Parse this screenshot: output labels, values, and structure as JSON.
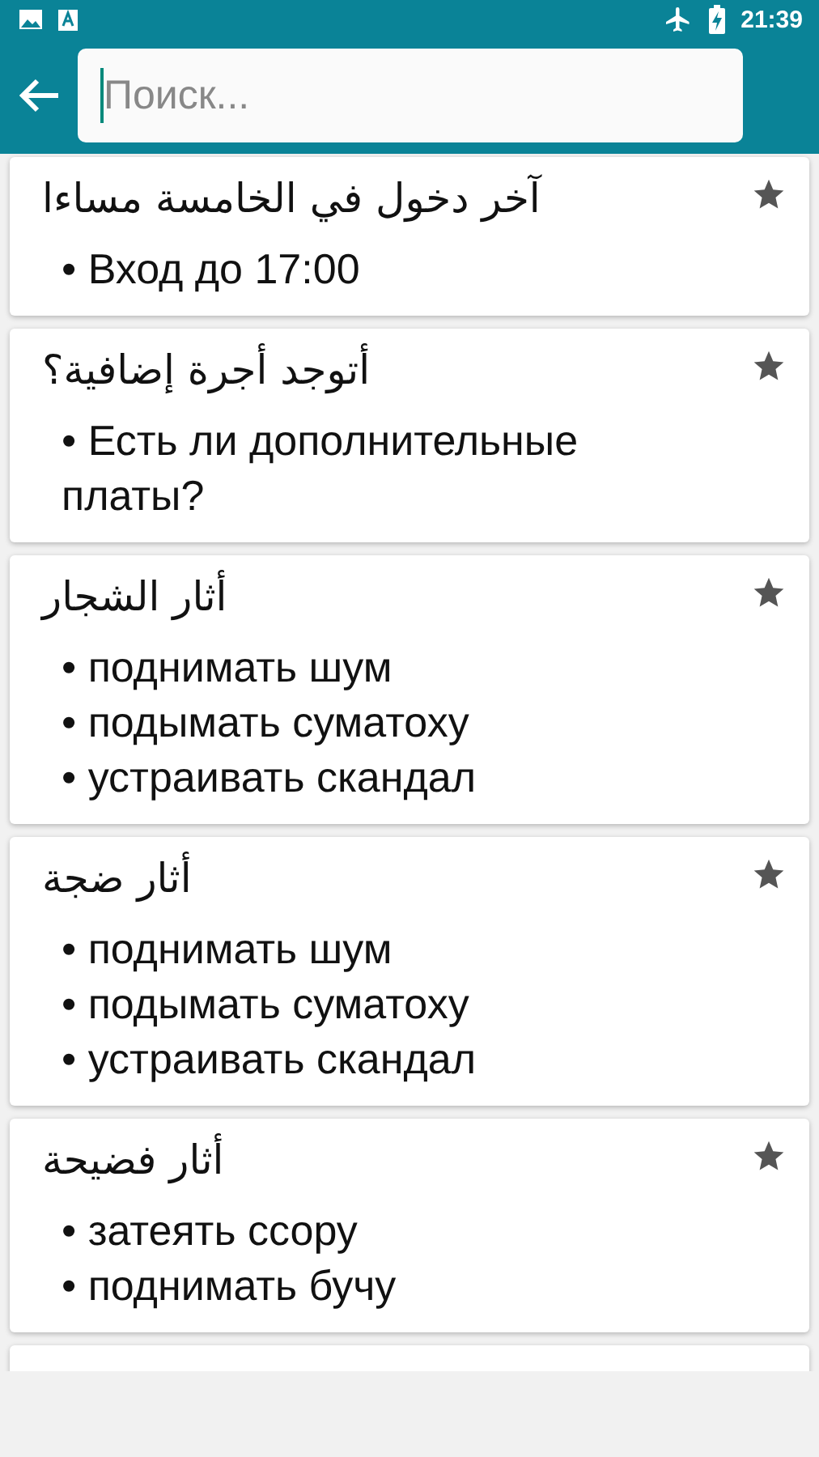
{
  "status_bar": {
    "time": "21:39"
  },
  "search": {
    "placeholder": "Поиск..."
  },
  "entries": [
    {
      "headword": "آخر دخول في الخامسة مساءا",
      "favorite": true,
      "translations": [
        "• Вход до 17:00"
      ]
    },
    {
      "headword": "أتوجد أجرة إضافية؟",
      "favorite": true,
      "translations": [
        "• Есть ли дополнительные платы?"
      ]
    },
    {
      "headword": "أثار الشجار",
      "favorite": true,
      "translations": [
        "• поднимать шум",
        "• подымать суматоху",
        "• устраивать скандал"
      ]
    },
    {
      "headword": "أثار ضجة",
      "favorite": true,
      "translations": [
        "• поднимать шум",
        "• подымать суматоху",
        "• устраивать скандал"
      ]
    },
    {
      "headword": "أثار فضيحة",
      "favorite": true,
      "translations": [
        "• затеять ссору",
        "• поднимать бучу"
      ]
    }
  ]
}
